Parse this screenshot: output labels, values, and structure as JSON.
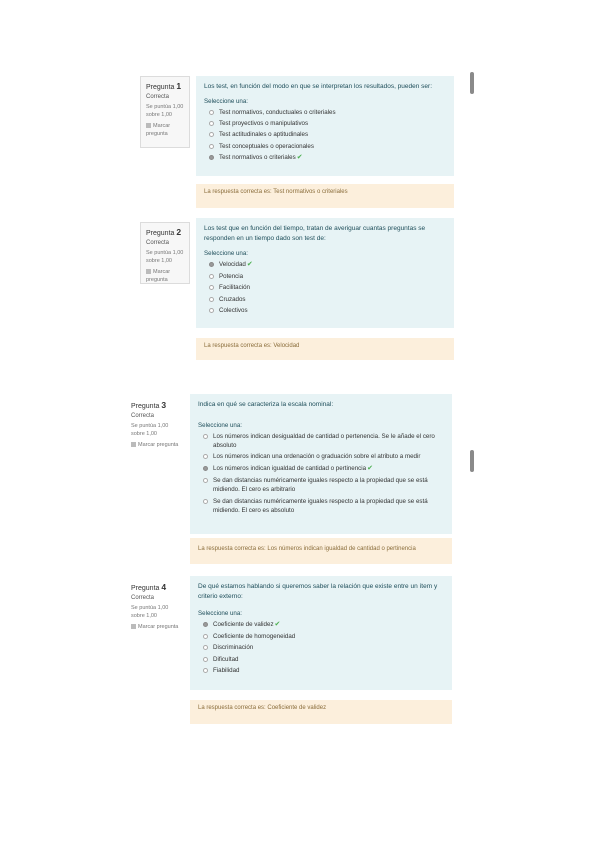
{
  "questions": [
    {
      "number_prefix": "Pregunta",
      "number": "1",
      "status": "Correcta",
      "grade": "Se puntúa 1,00 sobre 1,00",
      "flag_label": "Marcar pregunta",
      "text": "Los test, en función del modo en que se interpretan los resultados, pueden ser:",
      "prompt": "Seleccione una:",
      "options": [
        "Test normativos, conductuales o criteriales",
        "Test proyectivos o manipulativos",
        "Test actitudinales o aptitudinales",
        "Test conceptuales o operacionales",
        "Test normativos o criteriales"
      ],
      "selected_index": 4,
      "feedback": "La respuesta correcta es: Test normativos o criteriales"
    },
    {
      "number_prefix": "Pregunta",
      "number": "2",
      "status": "Correcta",
      "grade": "Se puntúa 1,00 sobre 1,00",
      "flag_label": "Marcar pregunta",
      "text": "Los test que en función del tiempo, tratan de averiguar cuantas preguntas se responden en un tiempo dado son test de:",
      "prompt": "Seleccione una:",
      "options": [
        "Velocidad",
        "Potencia",
        "Facilitación",
        "Cruzados",
        "Colectivos"
      ],
      "selected_index": 0,
      "feedback": "La respuesta correcta es: Velocidad"
    },
    {
      "number_prefix": "Pregunta",
      "number": "3",
      "status": "Correcta",
      "grade": "Se puntúa 1,00 sobre 1,00",
      "flag_label": "Marcar pregunta",
      "text": "Indica en qué se caracteriza la escala nominal:",
      "prompt": "Seleccione una:",
      "options": [
        "Los números indican desigualdad de cantidad o pertenencia. Se le añade el cero absoluto",
        "Los números indican una ordenación o graduación sobre el atributo a medir",
        "Los números indican igualdad de cantidad o pertinencia",
        "Se dan distancias numéricamente iguales respecto a la propiedad que se está midiendo. El cero es arbitrario",
        "Se dan distancias numéricamente iguales respecto a la propiedad que se está midiendo. El cero es absoluto"
      ],
      "selected_index": 2,
      "feedback": "La respuesta correcta es: Los números indican igualdad de cantidad o pertinencia"
    },
    {
      "number_prefix": "Pregunta",
      "number": "4",
      "status": "Correcta",
      "grade": "Se puntúa 1,00 sobre 1,00",
      "flag_label": "Marcar pregunta",
      "text": "De qué estamos hablando si queremos saber la relación que existe entre un ítem y criterio externo:",
      "prompt": "Seleccione una:",
      "options": [
        "Coeficiente de validez",
        "Coeficiente de homogeneidad",
        "Discriminación",
        "Dificultad",
        "Fiabilidad"
      ],
      "selected_index": 0,
      "feedback": "La respuesta correcta es: Coeficiente de validez"
    }
  ],
  "colors": {
    "question_bg": "#e7f3f5",
    "feedback_bg": "#fcefdc",
    "correct_check": "#4caf50"
  },
  "icons": {
    "correct": "check-icon",
    "flag": "flag-icon"
  }
}
